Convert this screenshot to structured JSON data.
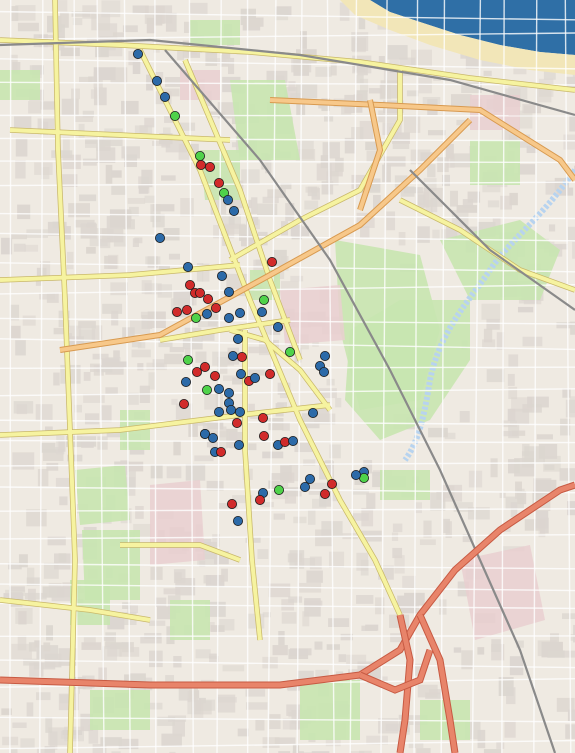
{
  "map": {
    "colors": {
      "land": "#efeae2",
      "block": "#dcd6d0",
      "park": "#c8e6b0",
      "water": "#2f6fa6",
      "beach": "#f2e6b8",
      "main_road": "#f6f3a0",
      "major_road": "#f7c88a",
      "highway": "#e8846a",
      "railway": "#8a8a8a",
      "canal": "#b7d3ef",
      "pink_zone": "#e9cfd0",
      "minor_road": "#ffffff"
    },
    "marker_colors": {
      "blue": "#2c6aa8",
      "red": "#d12b2b",
      "green": "#4fd24a"
    }
  },
  "markers": [
    {
      "color": "blue"
    },
    {
      "color": "blue"
    },
    {
      "color": "blue"
    },
    {
      "color": "green"
    },
    {
      "color": "green"
    },
    {
      "color": "red"
    },
    {
      "color": "red"
    },
    {
      "color": "red"
    },
    {
      "color": "green"
    },
    {
      "color": "blue"
    },
    {
      "color": "blue"
    },
    {
      "color": "blue"
    },
    {
      "color": "blue"
    },
    {
      "color": "blue"
    },
    {
      "color": "red"
    },
    {
      "color": "red"
    },
    {
      "color": "red"
    },
    {
      "color": "red"
    },
    {
      "color": "red"
    },
    {
      "color": "red"
    },
    {
      "color": "red"
    },
    {
      "color": "green"
    },
    {
      "color": "blue"
    },
    {
      "color": "green"
    },
    {
      "color": "blue"
    },
    {
      "color": "red"
    },
    {
      "color": "blue"
    },
    {
      "color": "blue"
    },
    {
      "color": "blue"
    },
    {
      "color": "blue"
    },
    {
      "color": "blue"
    },
    {
      "color": "blue"
    },
    {
      "color": "red"
    },
    {
      "color": "green"
    },
    {
      "color": "red"
    },
    {
      "color": "red"
    },
    {
      "color": "red"
    },
    {
      "color": "blue"
    },
    {
      "color": "blue"
    },
    {
      "color": "green"
    },
    {
      "color": "blue"
    },
    {
      "color": "blue"
    },
    {
      "color": "red"
    },
    {
      "color": "blue"
    },
    {
      "color": "red"
    },
    {
      "color": "red"
    },
    {
      "color": "blue"
    },
    {
      "color": "blue"
    },
    {
      "color": "blue"
    },
    {
      "color": "blue"
    },
    {
      "color": "red"
    },
    {
      "color": "blue"
    },
    {
      "color": "blue"
    },
    {
      "color": "blue"
    },
    {
      "color": "blue"
    },
    {
      "color": "red"
    },
    {
      "color": "red"
    },
    {
      "color": "blue"
    },
    {
      "color": "blue"
    },
    {
      "color": "red"
    },
    {
      "color": "red"
    },
    {
      "color": "blue"
    },
    {
      "color": "blue"
    },
    {
      "color": "blue"
    },
    {
      "color": "green"
    },
    {
      "color": "blue"
    },
    {
      "color": "blue"
    },
    {
      "color": "red"
    },
    {
      "color": "red"
    },
    {
      "color": "blue"
    },
    {
      "color": "blue"
    },
    {
      "color": "blue"
    },
    {
      "color": "green"
    },
    {
      "color": "blue"
    },
    {
      "color": "blue"
    },
    {
      "color": "red"
    },
    {
      "color": "green"
    },
    {
      "color": "red"
    },
    {
      "color": "blue"
    }
  ]
}
